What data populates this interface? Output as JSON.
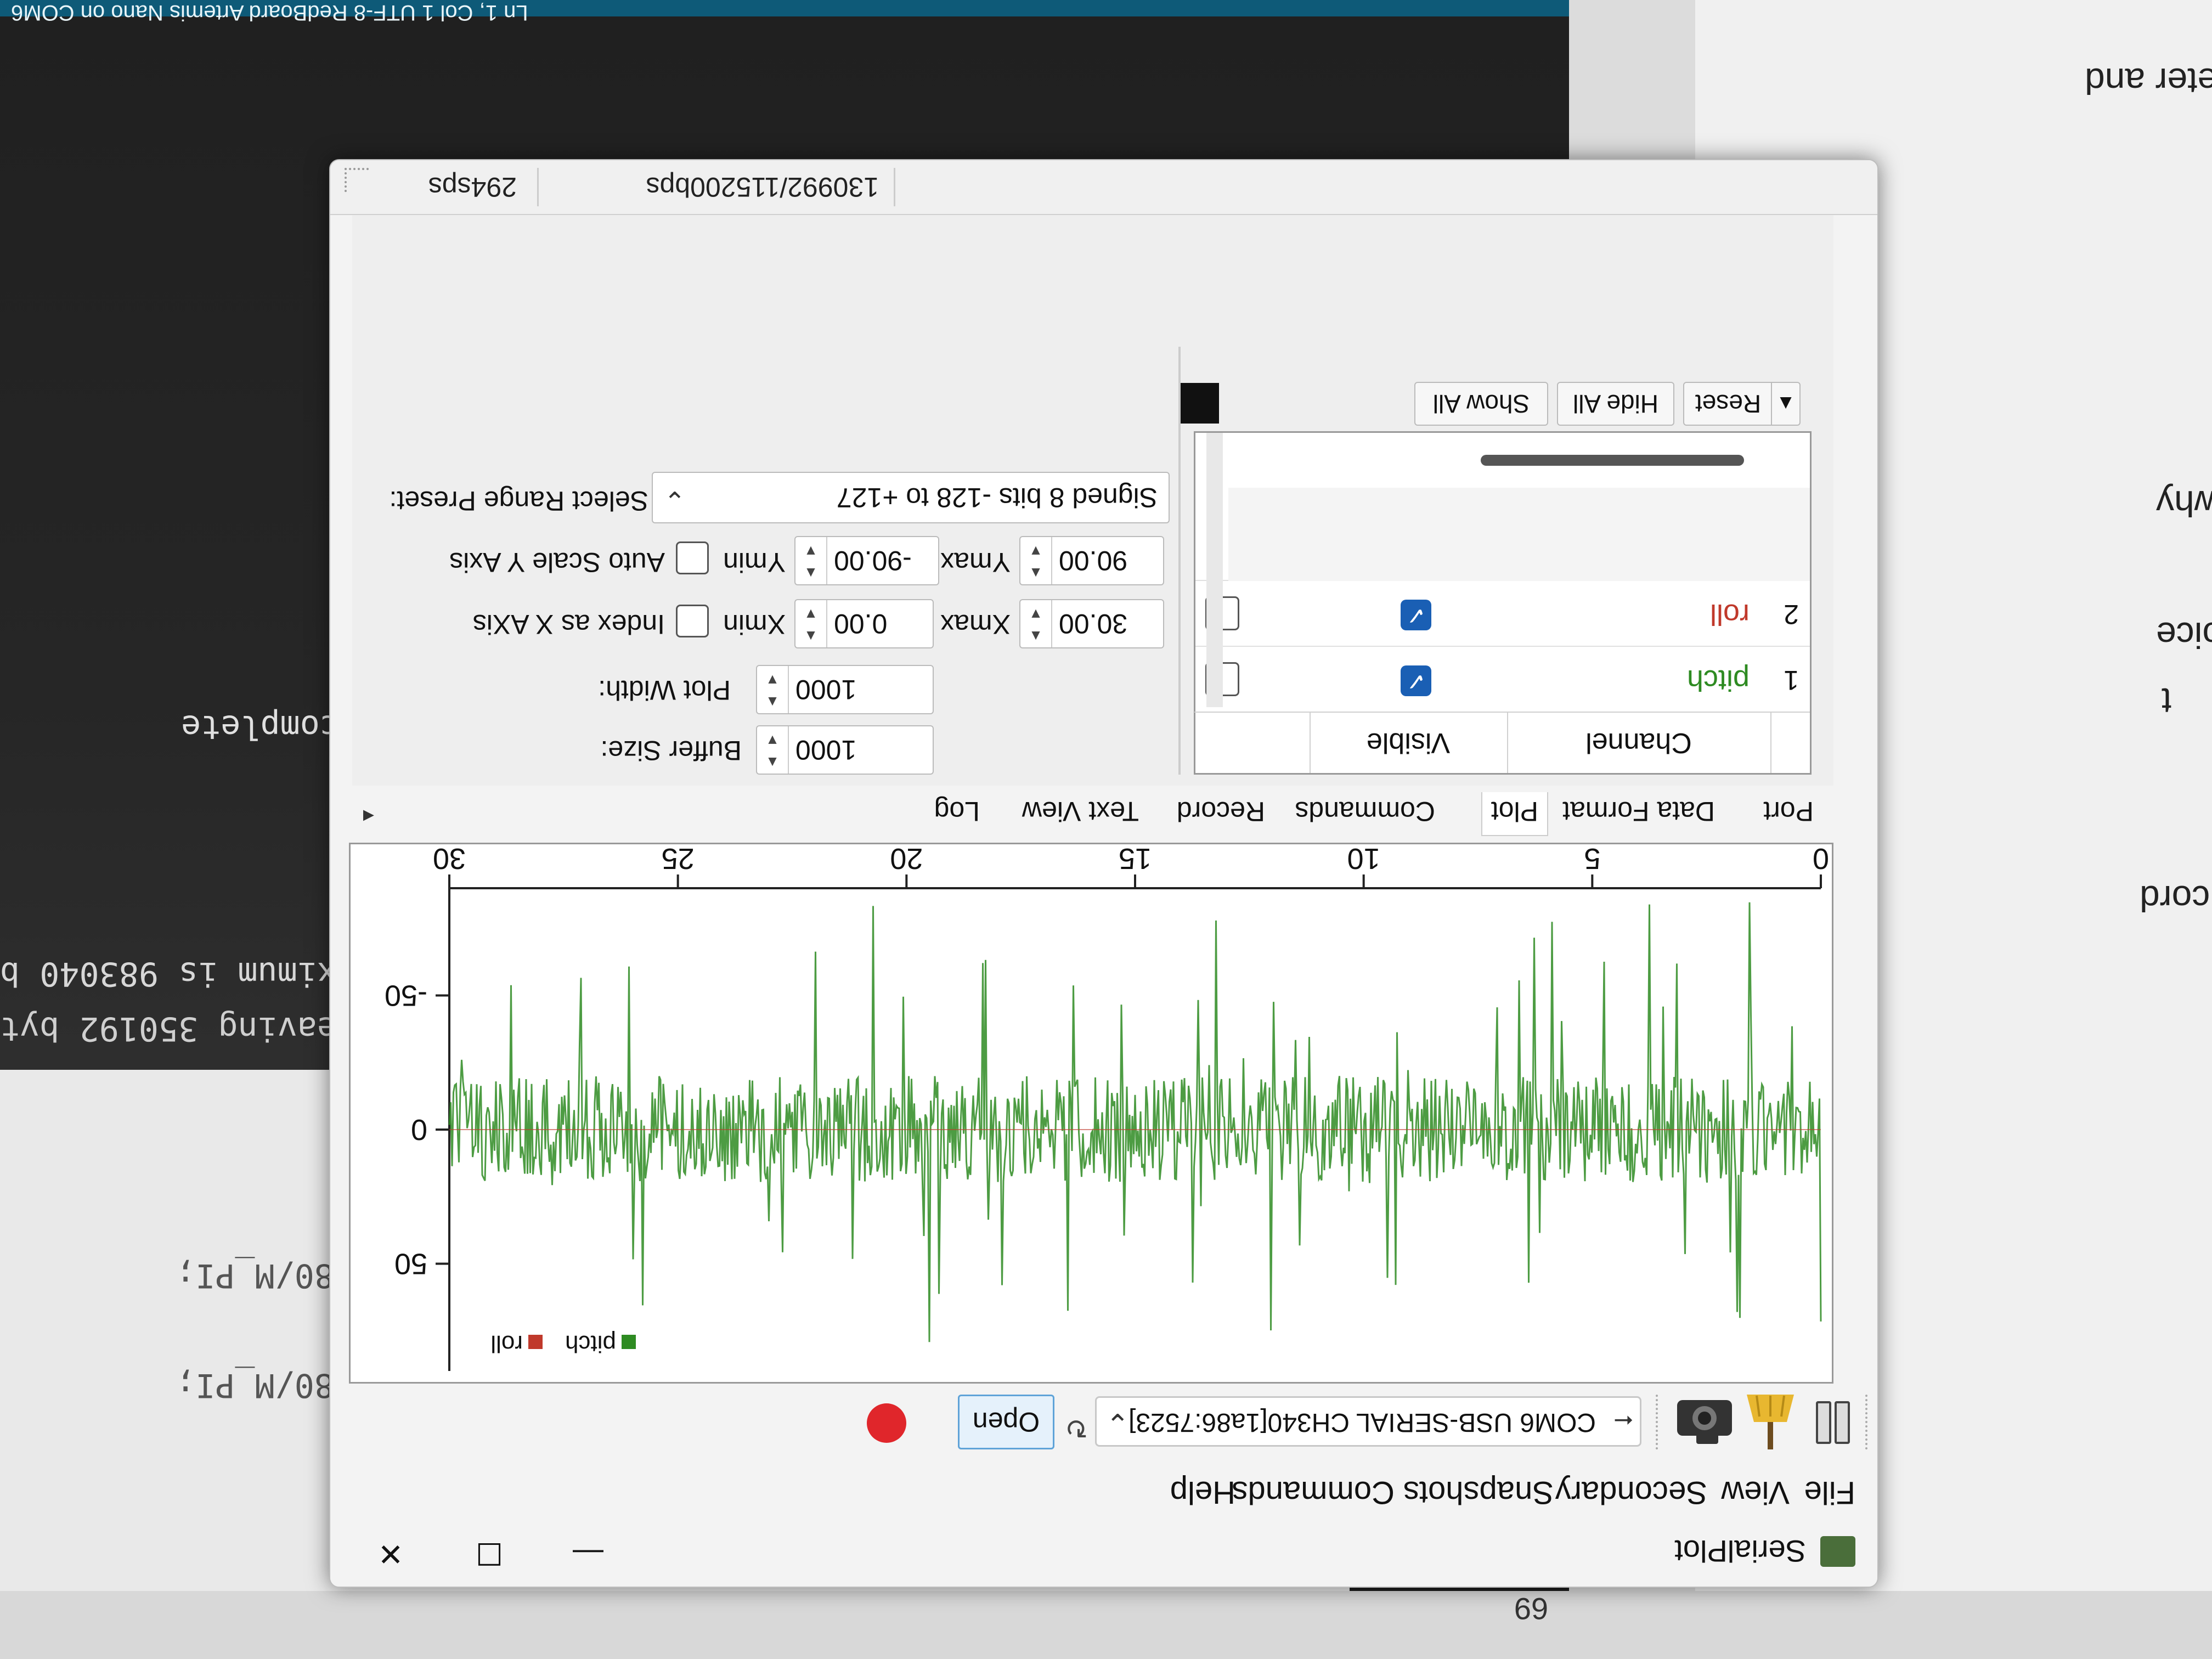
{
  "background": {
    "status_text": "Ln 1, Col 1   UTF-8   RedBoard Artemis Nano on COM6",
    "terminal_complete": "complete",
    "terminal_line1": "aximum is 983040 b",
    "terminal_line2": "Leaving 350192 byt",
    "code_line1": "80/M_PI;",
    "code_line2": "80/M_PI;",
    "doc_line1": "eter and",
    "doc_line2": "why",
    "doc_line3": "oice",
    "doc_line4": "t",
    "doc_line5": "cord",
    "line_number": "69"
  },
  "window": {
    "title": "SerialPlot",
    "minimize": "—",
    "maximize": "☐",
    "close": "✕"
  },
  "menu": [
    "File",
    "View",
    "Secondary",
    "Snapshots",
    "Commands",
    "Help"
  ],
  "toolbar": {
    "pause_icon": "pause-icon",
    "clear_icon": "broom-icon",
    "snapshot_icon": "camera-icon",
    "port_icon": "usb-icon",
    "port": "COM6 USB-SERIAL CH340[1a86:7523]",
    "refresh_icon": "refresh-icon",
    "open_label": "Open",
    "record_icon": "record-icon",
    "record_color": "#e0262b"
  },
  "chart_data": {
    "type": "line",
    "x_ticks": [
      "0",
      "5",
      "10",
      "15",
      "20",
      "25",
      "30"
    ],
    "y_ticks": [
      "50",
      "0",
      "-50"
    ],
    "xlim": [
      0,
      30
    ],
    "ylim": [
      -90,
      90
    ],
    "series": [
      {
        "name": "pitch",
        "color": "#2e8b22"
      },
      {
        "name": "roll",
        "color": "#c0392b"
      }
    ],
    "legend": [
      "pitch",
      "roll"
    ],
    "legend_position": "top-right"
  },
  "tabs": {
    "items": [
      "Port",
      "Data Format",
      "Plot",
      "Commands",
      "Record",
      "Text View",
      "Log"
    ],
    "active": "Plot"
  },
  "channels": {
    "headers": [
      "Channel",
      "Visible"
    ],
    "rows": [
      {
        "num": "1",
        "name": "pitch",
        "color": "#2e8b22",
        "visible": true
      },
      {
        "num": "2",
        "name": "roll",
        "color": "#c0392b",
        "visible": true
      }
    ],
    "buttons": {
      "show_all": "Show All",
      "hide_all": "Hide All",
      "reset": "Reset"
    }
  },
  "plot_settings": {
    "buffer_size_label": "Buffer Size:",
    "buffer_size": "1000",
    "plot_width_label": "Plot Width:",
    "plot_width": "1000",
    "index_x_label": "Index as X AXis",
    "xmin_label": "Xmin",
    "xmin": "0.00",
    "xmax_label": "Xmax",
    "xmax": "30.00",
    "auto_scale_label": "Auto Scale Y Axis",
    "ymin_label": "Ymin",
    "ymin": "-90.00",
    "ymax_label": "Ymax",
    "ymax": "90.00",
    "range_preset_label": "Select Range Preset:",
    "range_preset": "Signed 8 bits -128 to +127"
  },
  "status": {
    "bps": "130992/115200bps",
    "sps": "294sps"
  }
}
